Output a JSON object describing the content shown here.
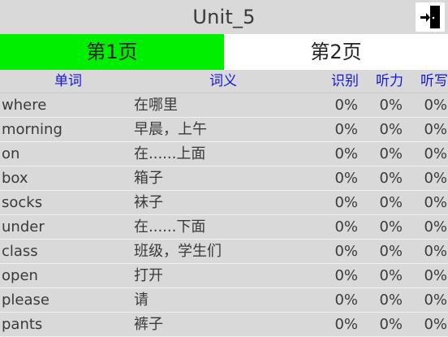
{
  "header": {
    "title": "Unit_5",
    "exit_icon": "exit-door-icon"
  },
  "tabs": [
    {
      "label": "第1页",
      "active": true
    },
    {
      "label": "第2页",
      "active": false
    }
  ],
  "columns": {
    "word": "单词",
    "meaning": "词义",
    "recognize": "识别",
    "listen": "听力",
    "dictation": "听写"
  },
  "rows": [
    {
      "word": "where",
      "meaning": "在哪里",
      "recognize": "0%",
      "listen": "0%",
      "dictation": "0%"
    },
    {
      "word": "morning",
      "meaning": "早晨，上午",
      "recognize": "0%",
      "listen": "0%",
      "dictation": "0%"
    },
    {
      "word": "on",
      "meaning": "在......上面",
      "recognize": "0%",
      "listen": "0%",
      "dictation": "0%"
    },
    {
      "word": "box",
      "meaning": "箱子",
      "recognize": "0%",
      "listen": "0%",
      "dictation": "0%"
    },
    {
      "word": "socks",
      "meaning": "袜子",
      "recognize": "0%",
      "listen": "0%",
      "dictation": "0%"
    },
    {
      "word": "under",
      "meaning": "在......下面",
      "recognize": "0%",
      "listen": "0%",
      "dictation": "0%"
    },
    {
      "word": "class",
      "meaning": "班级，学生们",
      "recognize": "0%",
      "listen": "0%",
      "dictation": "0%"
    },
    {
      "word": "open",
      "meaning": "打开",
      "recognize": "0%",
      "listen": "0%",
      "dictation": "0%"
    },
    {
      "word": "please",
      "meaning": "请",
      "recognize": "0%",
      "listen": "0%",
      "dictation": "0%"
    },
    {
      "word": "pants",
      "meaning": "裤子",
      "recognize": "0%",
      "listen": "0%",
      "dictation": "0%"
    }
  ],
  "colors": {
    "active_tab": "#00ee00",
    "inactive_tab": "#ffffff",
    "header_text": "#1515dd",
    "background": "#d9d9d9"
  }
}
